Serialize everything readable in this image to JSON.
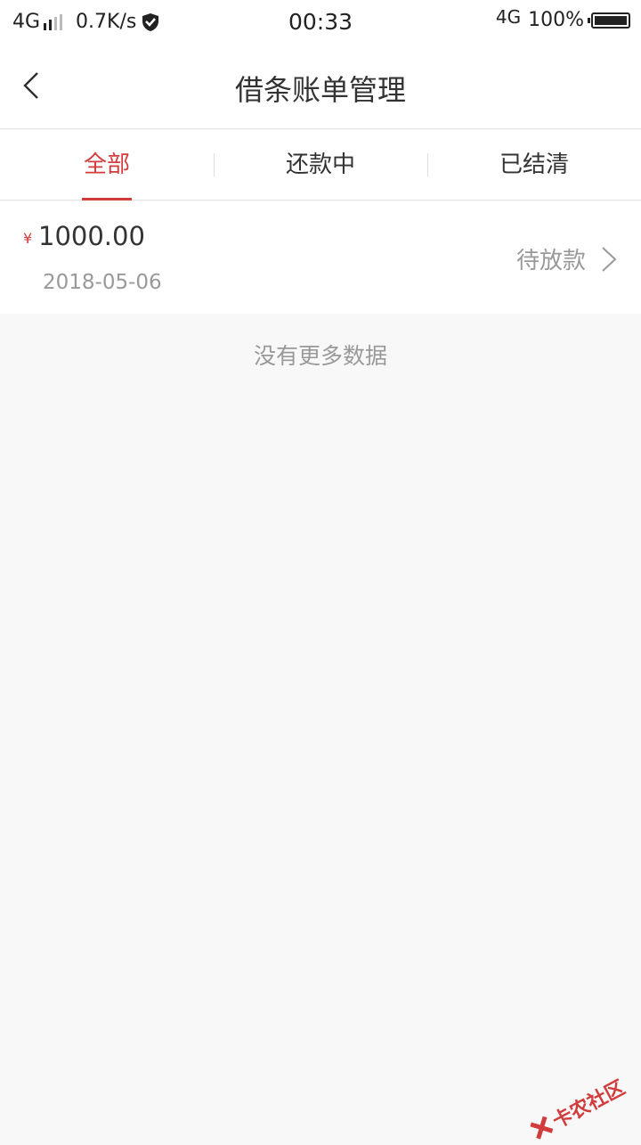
{
  "status_bar": {
    "network_left": "4G",
    "net_speed": "0.7K/s",
    "time": "00:33",
    "network_right": "4G",
    "battery": "100%"
  },
  "nav": {
    "title": "借条账单管理",
    "back_icon": "chevron-left-icon"
  },
  "tabs": [
    {
      "label": "全部",
      "active": true
    },
    {
      "label": "还款中",
      "active": false
    },
    {
      "label": "已结清",
      "active": false
    }
  ],
  "bills": [
    {
      "currency": "¥",
      "amount": "1000.00",
      "date": "2018-05-06",
      "status": "待放款"
    }
  ],
  "no_more": "没有更多数据",
  "watermark": "卡农社区",
  "colors": {
    "accent": "#d23c3c",
    "background": "#f8f8f8",
    "muted_text": "#999999"
  }
}
